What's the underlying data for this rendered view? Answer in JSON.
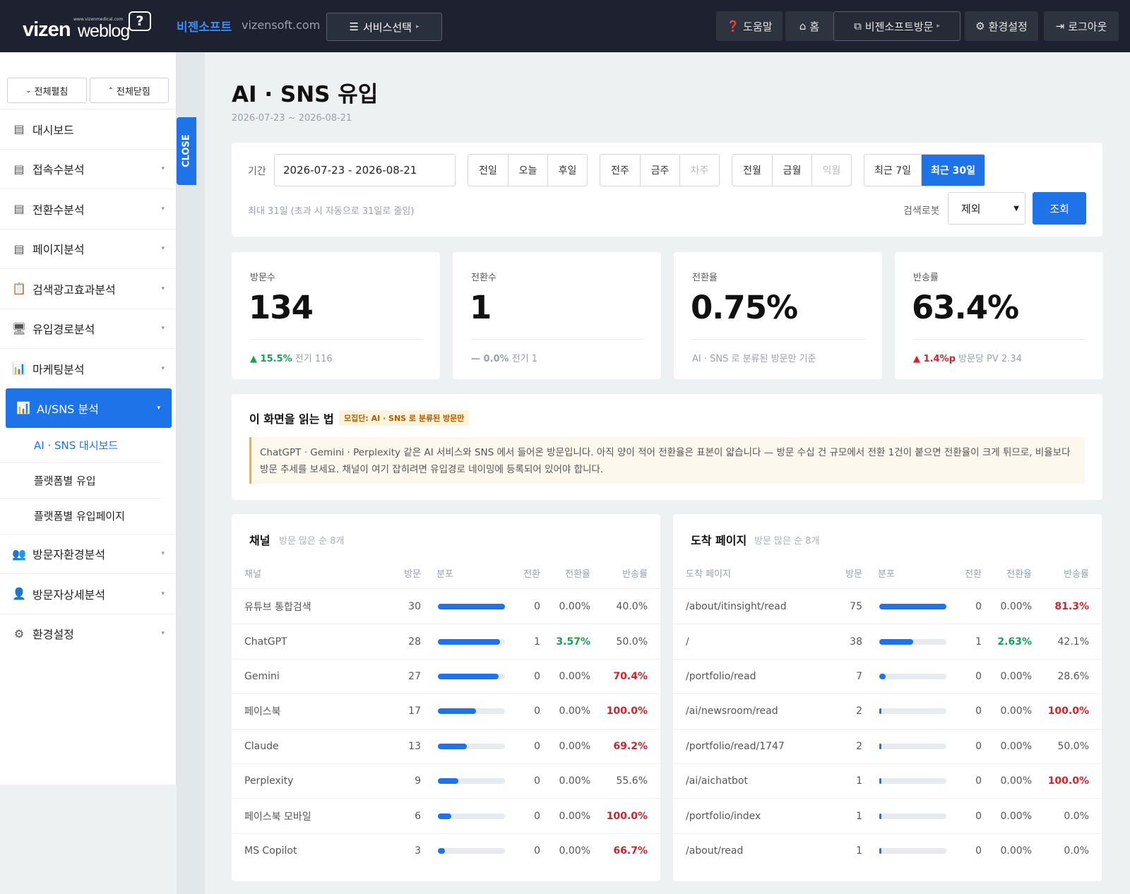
{
  "header": {
    "logo_main": "vizen",
    "logo_sub": "weblog",
    "logo_tiny": "www.vizenmedical.com",
    "site_name": "비젠소프트",
    "site_domain": "vizensoft.com",
    "service_select": "서비스선택",
    "help": "도움말",
    "home": "홈",
    "visit": "비젠소프트방문",
    "settings": "환경설정",
    "logout": "로그아웃"
  },
  "sidebar": {
    "expand_all": "전체펼침",
    "collapse_all": "전체닫힘",
    "close_tab": "CLOSE",
    "items": [
      {
        "label": "대시보드",
        "icon": "report-icon"
      },
      {
        "label": "접속수분석",
        "icon": "report-icon"
      },
      {
        "label": "전환수분석",
        "icon": "report-icon"
      },
      {
        "label": "페이지분석",
        "icon": "report-icon"
      },
      {
        "label": "검색광고효과분석",
        "icon": "clipboard-icon"
      },
      {
        "label": "유입경로분석",
        "icon": "monitor-icon"
      },
      {
        "label": "마케팅분석",
        "icon": "bar-chart-icon"
      },
      {
        "label": "AI/SNS 분석",
        "icon": "bar-chart-icon"
      },
      {
        "label": "방문자환경분석",
        "icon": "users-icon"
      },
      {
        "label": "방문자상세분석",
        "icon": "user-detail-icon"
      },
      {
        "label": "환경설정",
        "icon": "gear-icon"
      }
    ],
    "subitems": [
      "AI · SNS 대시보드",
      "플랫폼별 유입",
      "플랫폼별 유입페이지"
    ]
  },
  "page": {
    "title": "AI · SNS 유입",
    "range": "2026-07-23 ~ 2026-08-21"
  },
  "filter": {
    "period_label": "기간",
    "date_value": "2026-07-23 - 2026-08-21",
    "day_buttons": [
      "전일",
      "오늘",
      "후일"
    ],
    "week_buttons": [
      "전주",
      "금주",
      "차주"
    ],
    "month_buttons": [
      "전월",
      "금월",
      "익월"
    ],
    "recent_buttons": [
      "최근 7일",
      "최근 30일"
    ],
    "note": "최대 31일 (초과 시 자동으로 31일로 줄임)",
    "robot_label": "검색로봇",
    "robot_value": "제외",
    "search_button": "조회"
  },
  "kpis": [
    {
      "label": "방문수",
      "value": "134",
      "delta": "▲ 15.5%",
      "delta_type": "up",
      "prev": "전기 116"
    },
    {
      "label": "전환수",
      "value": "1",
      "delta": "— 0.0%",
      "delta_type": "flat",
      "prev": "전기 1"
    },
    {
      "label": "전환율",
      "value": "0.75%",
      "delta": "",
      "delta_type": "none",
      "prev": "AI · SNS 로 분류된 방문만 기준"
    },
    {
      "label": "반송률",
      "value": "63.4%",
      "delta": "▲ 1.4%p",
      "delta_type": "upred",
      "prev": "방문당 PV 2.34"
    }
  ],
  "howto": {
    "title": "이 화면을 읽는 법",
    "badge": "모집단: AI · SNS 로 분류된 방문만",
    "note": "ChatGPT · Gemini · Perplexity 같은 AI 서비스와 SNS 에서 들어온 방문입니다. 아직 양이 적어 전환율은 표본이 얇습니다 — 방문 수십 건 규모에서 전환 1건이 붙으면 전환율이 크게 튀므로, 비율보다 방문 추세를 보세요. 채널이 여기 잡히려면 유입경로 네이밍에 등록되어 있어야 합니다."
  },
  "channels": {
    "title": "채널",
    "subtitle": "방문 많은 순 8개",
    "columns": [
      "채널",
      "방문",
      "분포",
      "전환",
      "전환율",
      "반송률"
    ],
    "rows": [
      {
        "name": "유튜브 통합검색",
        "visits": "30",
        "share": 1.0,
        "conv": "0",
        "rate": "0.00%",
        "bounce": "40.0%",
        "rate_hi": false,
        "bounce_hi": false
      },
      {
        "name": "ChatGPT",
        "visits": "28",
        "share": 0.93,
        "conv": "1",
        "rate": "3.57%",
        "bounce": "50.0%",
        "rate_hi": true,
        "bounce_hi": false
      },
      {
        "name": "Gemini",
        "visits": "27",
        "share": 0.9,
        "conv": "0",
        "rate": "0.00%",
        "bounce": "70.4%",
        "rate_hi": false,
        "bounce_hi": true
      },
      {
        "name": "페이스북",
        "visits": "17",
        "share": 0.57,
        "conv": "0",
        "rate": "0.00%",
        "bounce": "100.0%",
        "rate_hi": false,
        "bounce_hi": true
      },
      {
        "name": "Claude",
        "visits": "13",
        "share": 0.43,
        "conv": "0",
        "rate": "0.00%",
        "bounce": "69.2%",
        "rate_hi": false,
        "bounce_hi": true
      },
      {
        "name": "Perplexity",
        "visits": "9",
        "share": 0.3,
        "conv": "0",
        "rate": "0.00%",
        "bounce": "55.6%",
        "rate_hi": false,
        "bounce_hi": false
      },
      {
        "name": "페이스북 모바일",
        "visits": "6",
        "share": 0.2,
        "conv": "0",
        "rate": "0.00%",
        "bounce": "100.0%",
        "rate_hi": false,
        "bounce_hi": true
      },
      {
        "name": "MS Copilot",
        "visits": "3",
        "share": 0.1,
        "conv": "0",
        "rate": "0.00%",
        "bounce": "66.7%",
        "rate_hi": false,
        "bounce_hi": true
      }
    ]
  },
  "landing": {
    "title": "도착 페이지",
    "subtitle": "방문 많은 순 8개",
    "columns": [
      "도착 페이지",
      "방문",
      "분포",
      "전환",
      "전환율",
      "반송률"
    ],
    "rows": [
      {
        "name": "/about/itinsight/read",
        "visits": "75",
        "share": 1.0,
        "conv": "0",
        "rate": "0.00%",
        "bounce": "81.3%",
        "rate_hi": false,
        "bounce_hi": true
      },
      {
        "name": "/",
        "visits": "38",
        "share": 0.51,
        "conv": "1",
        "rate": "2.63%",
        "bounce": "42.1%",
        "rate_hi": true,
        "bounce_hi": false
      },
      {
        "name": "/portfolio/read",
        "visits": "7",
        "share": 0.09,
        "conv": "0",
        "rate": "0.00%",
        "bounce": "28.6%",
        "rate_hi": false,
        "bounce_hi": false
      },
      {
        "name": "/ai/newsroom/read",
        "visits": "2",
        "share": 0.03,
        "conv": "0",
        "rate": "0.00%",
        "bounce": "100.0%",
        "rate_hi": false,
        "bounce_hi": true
      },
      {
        "name": "/portfolio/read/1747",
        "visits": "2",
        "share": 0.03,
        "conv": "0",
        "rate": "0.00%",
        "bounce": "50.0%",
        "rate_hi": false,
        "bounce_hi": false
      },
      {
        "name": "/ai/aichatbot",
        "visits": "1",
        "share": 0.013,
        "conv": "0",
        "rate": "0.00%",
        "bounce": "100.0%",
        "rate_hi": false,
        "bounce_hi": true
      },
      {
        "name": "/portfolio/index",
        "visits": "1",
        "share": 0.013,
        "conv": "0",
        "rate": "0.00%",
        "bounce": "0.0%",
        "rate_hi": false,
        "bounce_hi": false
      },
      {
        "name": "/about/read",
        "visits": "1",
        "share": 0.013,
        "conv": "0",
        "rate": "0.00%",
        "bounce": "0.0%",
        "rate_hi": false,
        "bounce_hi": false
      }
    ]
  },
  "colors": {
    "accent": "#1e73e8",
    "topbar": "#1e2230",
    "good": "#18a058",
    "bad": "#d0242c"
  }
}
